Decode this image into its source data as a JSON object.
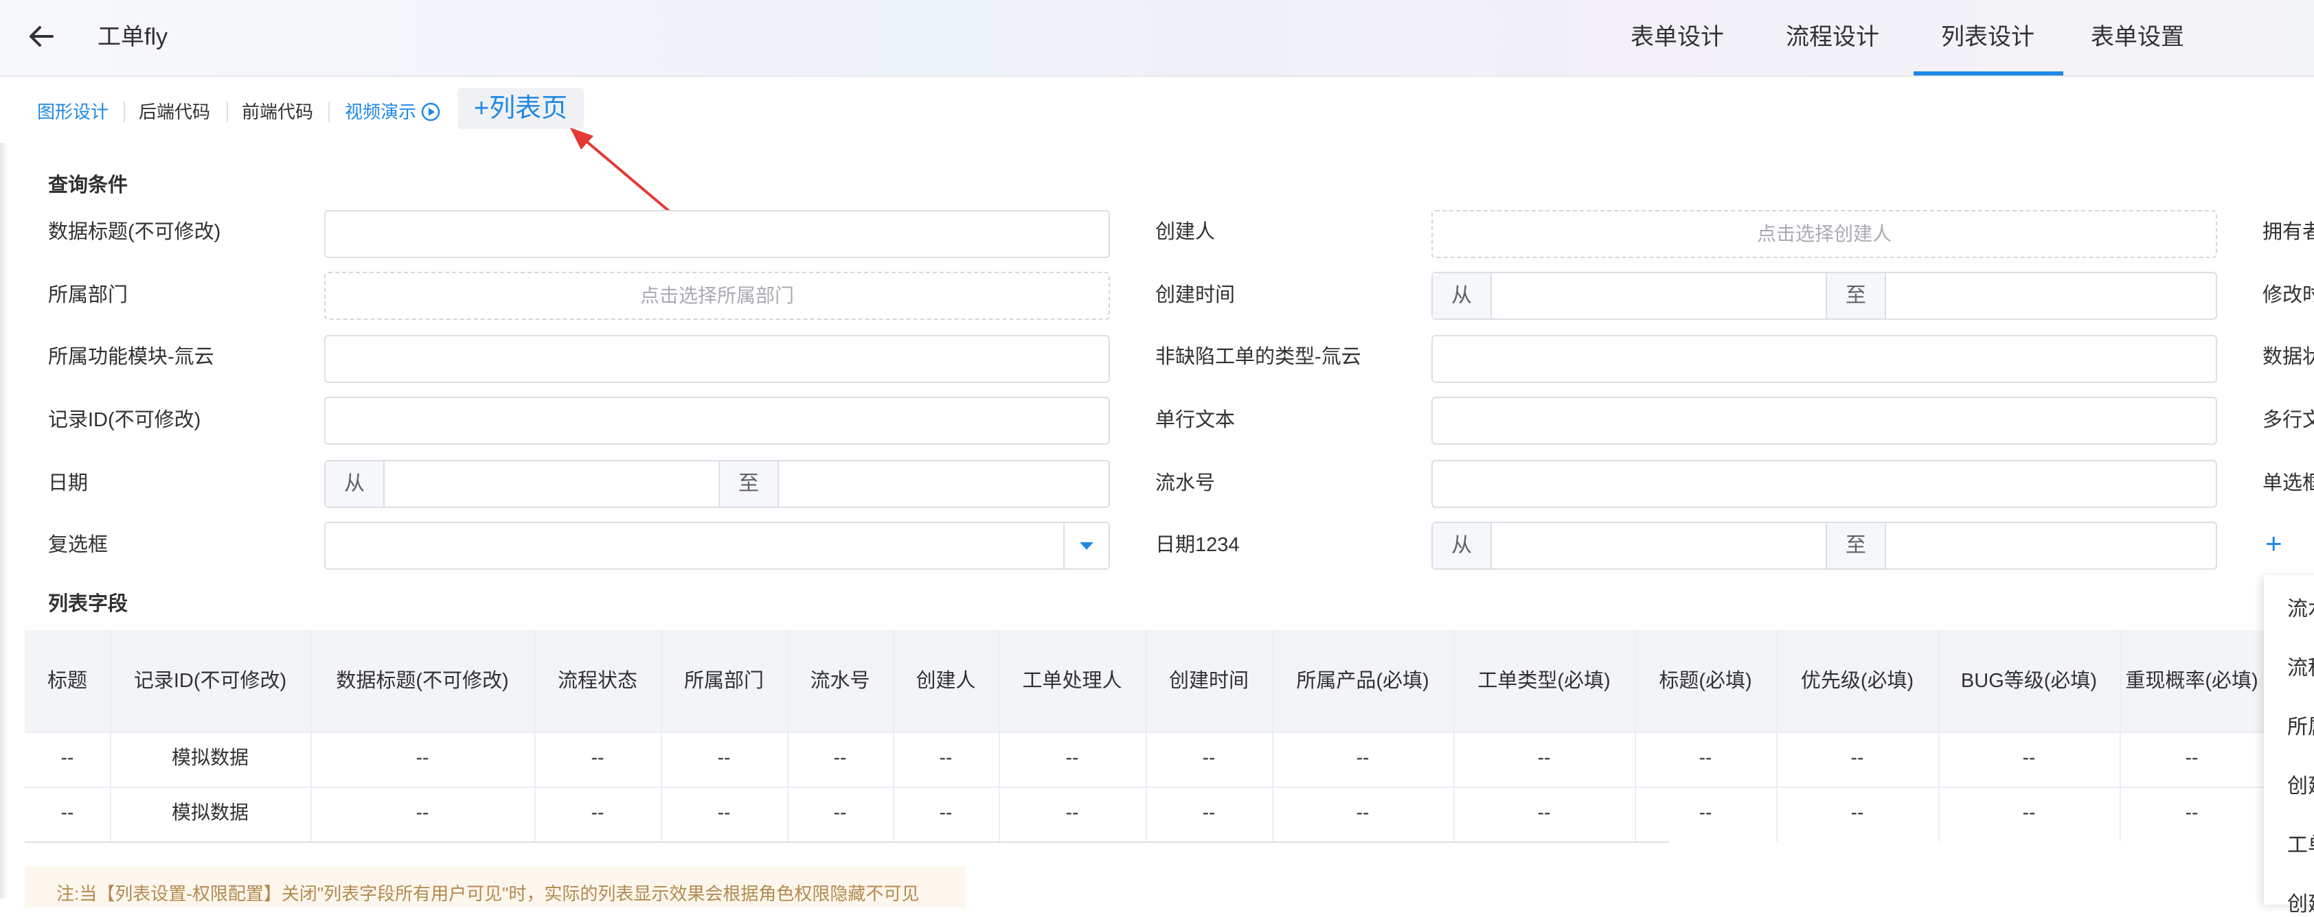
{
  "header": {
    "title": "工单fly",
    "tabs": [
      {
        "label": "表单设计"
      },
      {
        "label": "流程设计"
      },
      {
        "label": "列表设计",
        "active": true
      },
      {
        "label": "表单设置"
      }
    ]
  },
  "toolbar": {
    "graphic_design": "图形设计",
    "backend_code": "后端代码",
    "frontend_code": "前端代码",
    "video_demo": "视频演示",
    "add_list_page": "+列表页"
  },
  "query": {
    "title": "查询条件",
    "fields": {
      "data_title": "数据标题(不可修改)",
      "department": "所属部门",
      "department_placeholder": "点击选择所属部门",
      "module": "所属功能模块-氚云",
      "record_id": "记录ID(不可修改)",
      "date": "日期",
      "checkbox": "复选框",
      "creator": "创建人",
      "creator_placeholder": "点击选择创建人",
      "created_time": "创建时间",
      "non_defect_type": "非缺陷工单的类型-氚云",
      "single_text": "单行文本",
      "serial_no": "流水号",
      "date1234": "日期1234",
      "owner_partial": "拥有者",
      "modified_partial": "修改时",
      "data_status_partial": "数据状",
      "multi_text_partial": "多行文",
      "single_choice_partial": "单选框",
      "from": "从",
      "to": "至",
      "add_partial": "+"
    }
  },
  "list": {
    "title": "列表字段",
    "columns": [
      "标题",
      "记录ID(不可修改)",
      "数据标题(不可修改)",
      "流程状态",
      "所属部门",
      "流水号",
      "创建人",
      "工单处理人",
      "创建时间",
      "所属产品(必填)",
      "工单类型(必填)",
      "标题(必填)",
      "优先级(必填)",
      "BUG等级(必填)",
      "重现概率(必填)"
    ],
    "rows": [
      [
        "--",
        "模拟数据",
        "--",
        "--",
        "--",
        "--",
        "--",
        "--",
        "--",
        "--",
        "--",
        "--",
        "--",
        "--",
        "--"
      ],
      [
        "--",
        "模拟数据",
        "--",
        "--",
        "--",
        "--",
        "--",
        "--",
        "--",
        "--",
        "--",
        "--",
        "--",
        "--",
        "--"
      ]
    ],
    "note": "注:当【列表设置-权限配置】关闭\"列表字段所有用户可见\"时，实际的列表显示效果会根据角色权限隐藏不可见"
  },
  "dropdown": {
    "items": [
      "流水号",
      "流程状态",
      "所属部门",
      "创建人",
      "工单处理人",
      "创建时间"
    ]
  },
  "colors": {
    "accent": "#1e88e5",
    "annotation_arrow": "#e53935",
    "note_bg": "#fdf6ec"
  }
}
